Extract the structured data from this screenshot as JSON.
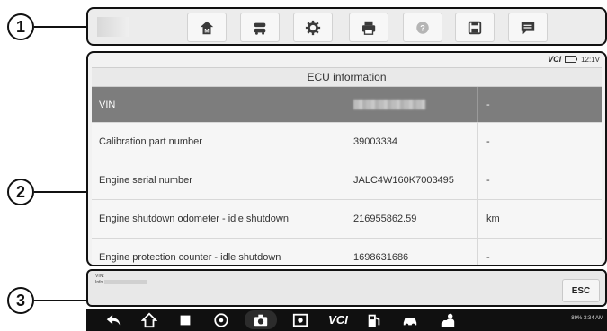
{
  "callouts": [
    "1",
    "2",
    "3"
  ],
  "toolbar": {
    "buttons": [
      {
        "name": "home-icon"
      },
      {
        "name": "vehicle-swap-icon"
      },
      {
        "name": "settings-icon"
      },
      {
        "name": "print-icon"
      },
      {
        "name": "help-icon"
      },
      {
        "name": "save-icon"
      },
      {
        "name": "message-icon"
      }
    ]
  },
  "status_bar": {
    "vci": "VCI",
    "time": "12:1V"
  },
  "ecu": {
    "title": "ECU information",
    "rows": [
      {
        "label": "VIN",
        "value": "",
        "unit": "-",
        "highlighted": true
      },
      {
        "label": "Calibration part number",
        "value": "39003334",
        "unit": "-"
      },
      {
        "label": "Engine serial number",
        "value": "JALC4W160K7003495",
        "unit": "-"
      },
      {
        "label": "Engine shutdown odometer - idle shutdown",
        "value": "216955862.59",
        "unit": "km"
      },
      {
        "label": "Engine protection counter - idle shutdown",
        "value": "1698631686",
        "unit": "-"
      }
    ]
  },
  "info_panel": {
    "line1": "VIN:",
    "line2": "Info",
    "esc_label": "ESC"
  },
  "navbar": {
    "vci_label": "VCI",
    "status": "89% 3:34 AM"
  }
}
